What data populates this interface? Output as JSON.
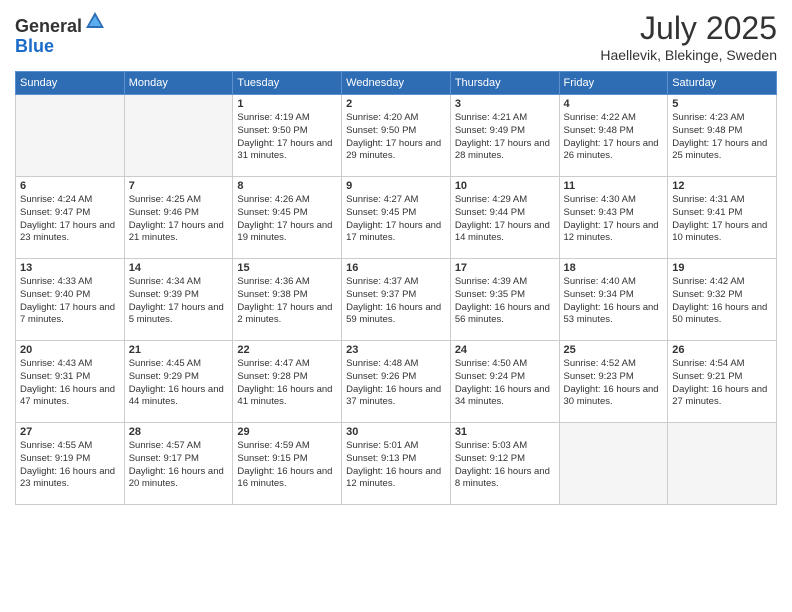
{
  "header": {
    "logo_line1": "General",
    "logo_line2": "Blue",
    "month_title": "July 2025",
    "location": "Haellevik, Blekinge, Sweden"
  },
  "days_of_week": [
    "Sunday",
    "Monday",
    "Tuesday",
    "Wednesday",
    "Thursday",
    "Friday",
    "Saturday"
  ],
  "weeks": [
    [
      {
        "day": "",
        "info": ""
      },
      {
        "day": "",
        "info": ""
      },
      {
        "day": "1",
        "info": "Sunrise: 4:19 AM\nSunset: 9:50 PM\nDaylight: 17 hours and 31 minutes."
      },
      {
        "day": "2",
        "info": "Sunrise: 4:20 AM\nSunset: 9:50 PM\nDaylight: 17 hours and 29 minutes."
      },
      {
        "day": "3",
        "info": "Sunrise: 4:21 AM\nSunset: 9:49 PM\nDaylight: 17 hours and 28 minutes."
      },
      {
        "day": "4",
        "info": "Sunrise: 4:22 AM\nSunset: 9:48 PM\nDaylight: 17 hours and 26 minutes."
      },
      {
        "day": "5",
        "info": "Sunrise: 4:23 AM\nSunset: 9:48 PM\nDaylight: 17 hours and 25 minutes."
      }
    ],
    [
      {
        "day": "6",
        "info": "Sunrise: 4:24 AM\nSunset: 9:47 PM\nDaylight: 17 hours and 23 minutes."
      },
      {
        "day": "7",
        "info": "Sunrise: 4:25 AM\nSunset: 9:46 PM\nDaylight: 17 hours and 21 minutes."
      },
      {
        "day": "8",
        "info": "Sunrise: 4:26 AM\nSunset: 9:45 PM\nDaylight: 17 hours and 19 minutes."
      },
      {
        "day": "9",
        "info": "Sunrise: 4:27 AM\nSunset: 9:45 PM\nDaylight: 17 hours and 17 minutes."
      },
      {
        "day": "10",
        "info": "Sunrise: 4:29 AM\nSunset: 9:44 PM\nDaylight: 17 hours and 14 minutes."
      },
      {
        "day": "11",
        "info": "Sunrise: 4:30 AM\nSunset: 9:43 PM\nDaylight: 17 hours and 12 minutes."
      },
      {
        "day": "12",
        "info": "Sunrise: 4:31 AM\nSunset: 9:41 PM\nDaylight: 17 hours and 10 minutes."
      }
    ],
    [
      {
        "day": "13",
        "info": "Sunrise: 4:33 AM\nSunset: 9:40 PM\nDaylight: 17 hours and 7 minutes."
      },
      {
        "day": "14",
        "info": "Sunrise: 4:34 AM\nSunset: 9:39 PM\nDaylight: 17 hours and 5 minutes."
      },
      {
        "day": "15",
        "info": "Sunrise: 4:36 AM\nSunset: 9:38 PM\nDaylight: 17 hours and 2 minutes."
      },
      {
        "day": "16",
        "info": "Sunrise: 4:37 AM\nSunset: 9:37 PM\nDaylight: 16 hours and 59 minutes."
      },
      {
        "day": "17",
        "info": "Sunrise: 4:39 AM\nSunset: 9:35 PM\nDaylight: 16 hours and 56 minutes."
      },
      {
        "day": "18",
        "info": "Sunrise: 4:40 AM\nSunset: 9:34 PM\nDaylight: 16 hours and 53 minutes."
      },
      {
        "day": "19",
        "info": "Sunrise: 4:42 AM\nSunset: 9:32 PM\nDaylight: 16 hours and 50 minutes."
      }
    ],
    [
      {
        "day": "20",
        "info": "Sunrise: 4:43 AM\nSunset: 9:31 PM\nDaylight: 16 hours and 47 minutes."
      },
      {
        "day": "21",
        "info": "Sunrise: 4:45 AM\nSunset: 9:29 PM\nDaylight: 16 hours and 44 minutes."
      },
      {
        "day": "22",
        "info": "Sunrise: 4:47 AM\nSunset: 9:28 PM\nDaylight: 16 hours and 41 minutes."
      },
      {
        "day": "23",
        "info": "Sunrise: 4:48 AM\nSunset: 9:26 PM\nDaylight: 16 hours and 37 minutes."
      },
      {
        "day": "24",
        "info": "Sunrise: 4:50 AM\nSunset: 9:24 PM\nDaylight: 16 hours and 34 minutes."
      },
      {
        "day": "25",
        "info": "Sunrise: 4:52 AM\nSunset: 9:23 PM\nDaylight: 16 hours and 30 minutes."
      },
      {
        "day": "26",
        "info": "Sunrise: 4:54 AM\nSunset: 9:21 PM\nDaylight: 16 hours and 27 minutes."
      }
    ],
    [
      {
        "day": "27",
        "info": "Sunrise: 4:55 AM\nSunset: 9:19 PM\nDaylight: 16 hours and 23 minutes."
      },
      {
        "day": "28",
        "info": "Sunrise: 4:57 AM\nSunset: 9:17 PM\nDaylight: 16 hours and 20 minutes."
      },
      {
        "day": "29",
        "info": "Sunrise: 4:59 AM\nSunset: 9:15 PM\nDaylight: 16 hours and 16 minutes."
      },
      {
        "day": "30",
        "info": "Sunrise: 5:01 AM\nSunset: 9:13 PM\nDaylight: 16 hours and 12 minutes."
      },
      {
        "day": "31",
        "info": "Sunrise: 5:03 AM\nSunset: 9:12 PM\nDaylight: 16 hours and 8 minutes."
      },
      {
        "day": "",
        "info": ""
      },
      {
        "day": "",
        "info": ""
      }
    ]
  ]
}
